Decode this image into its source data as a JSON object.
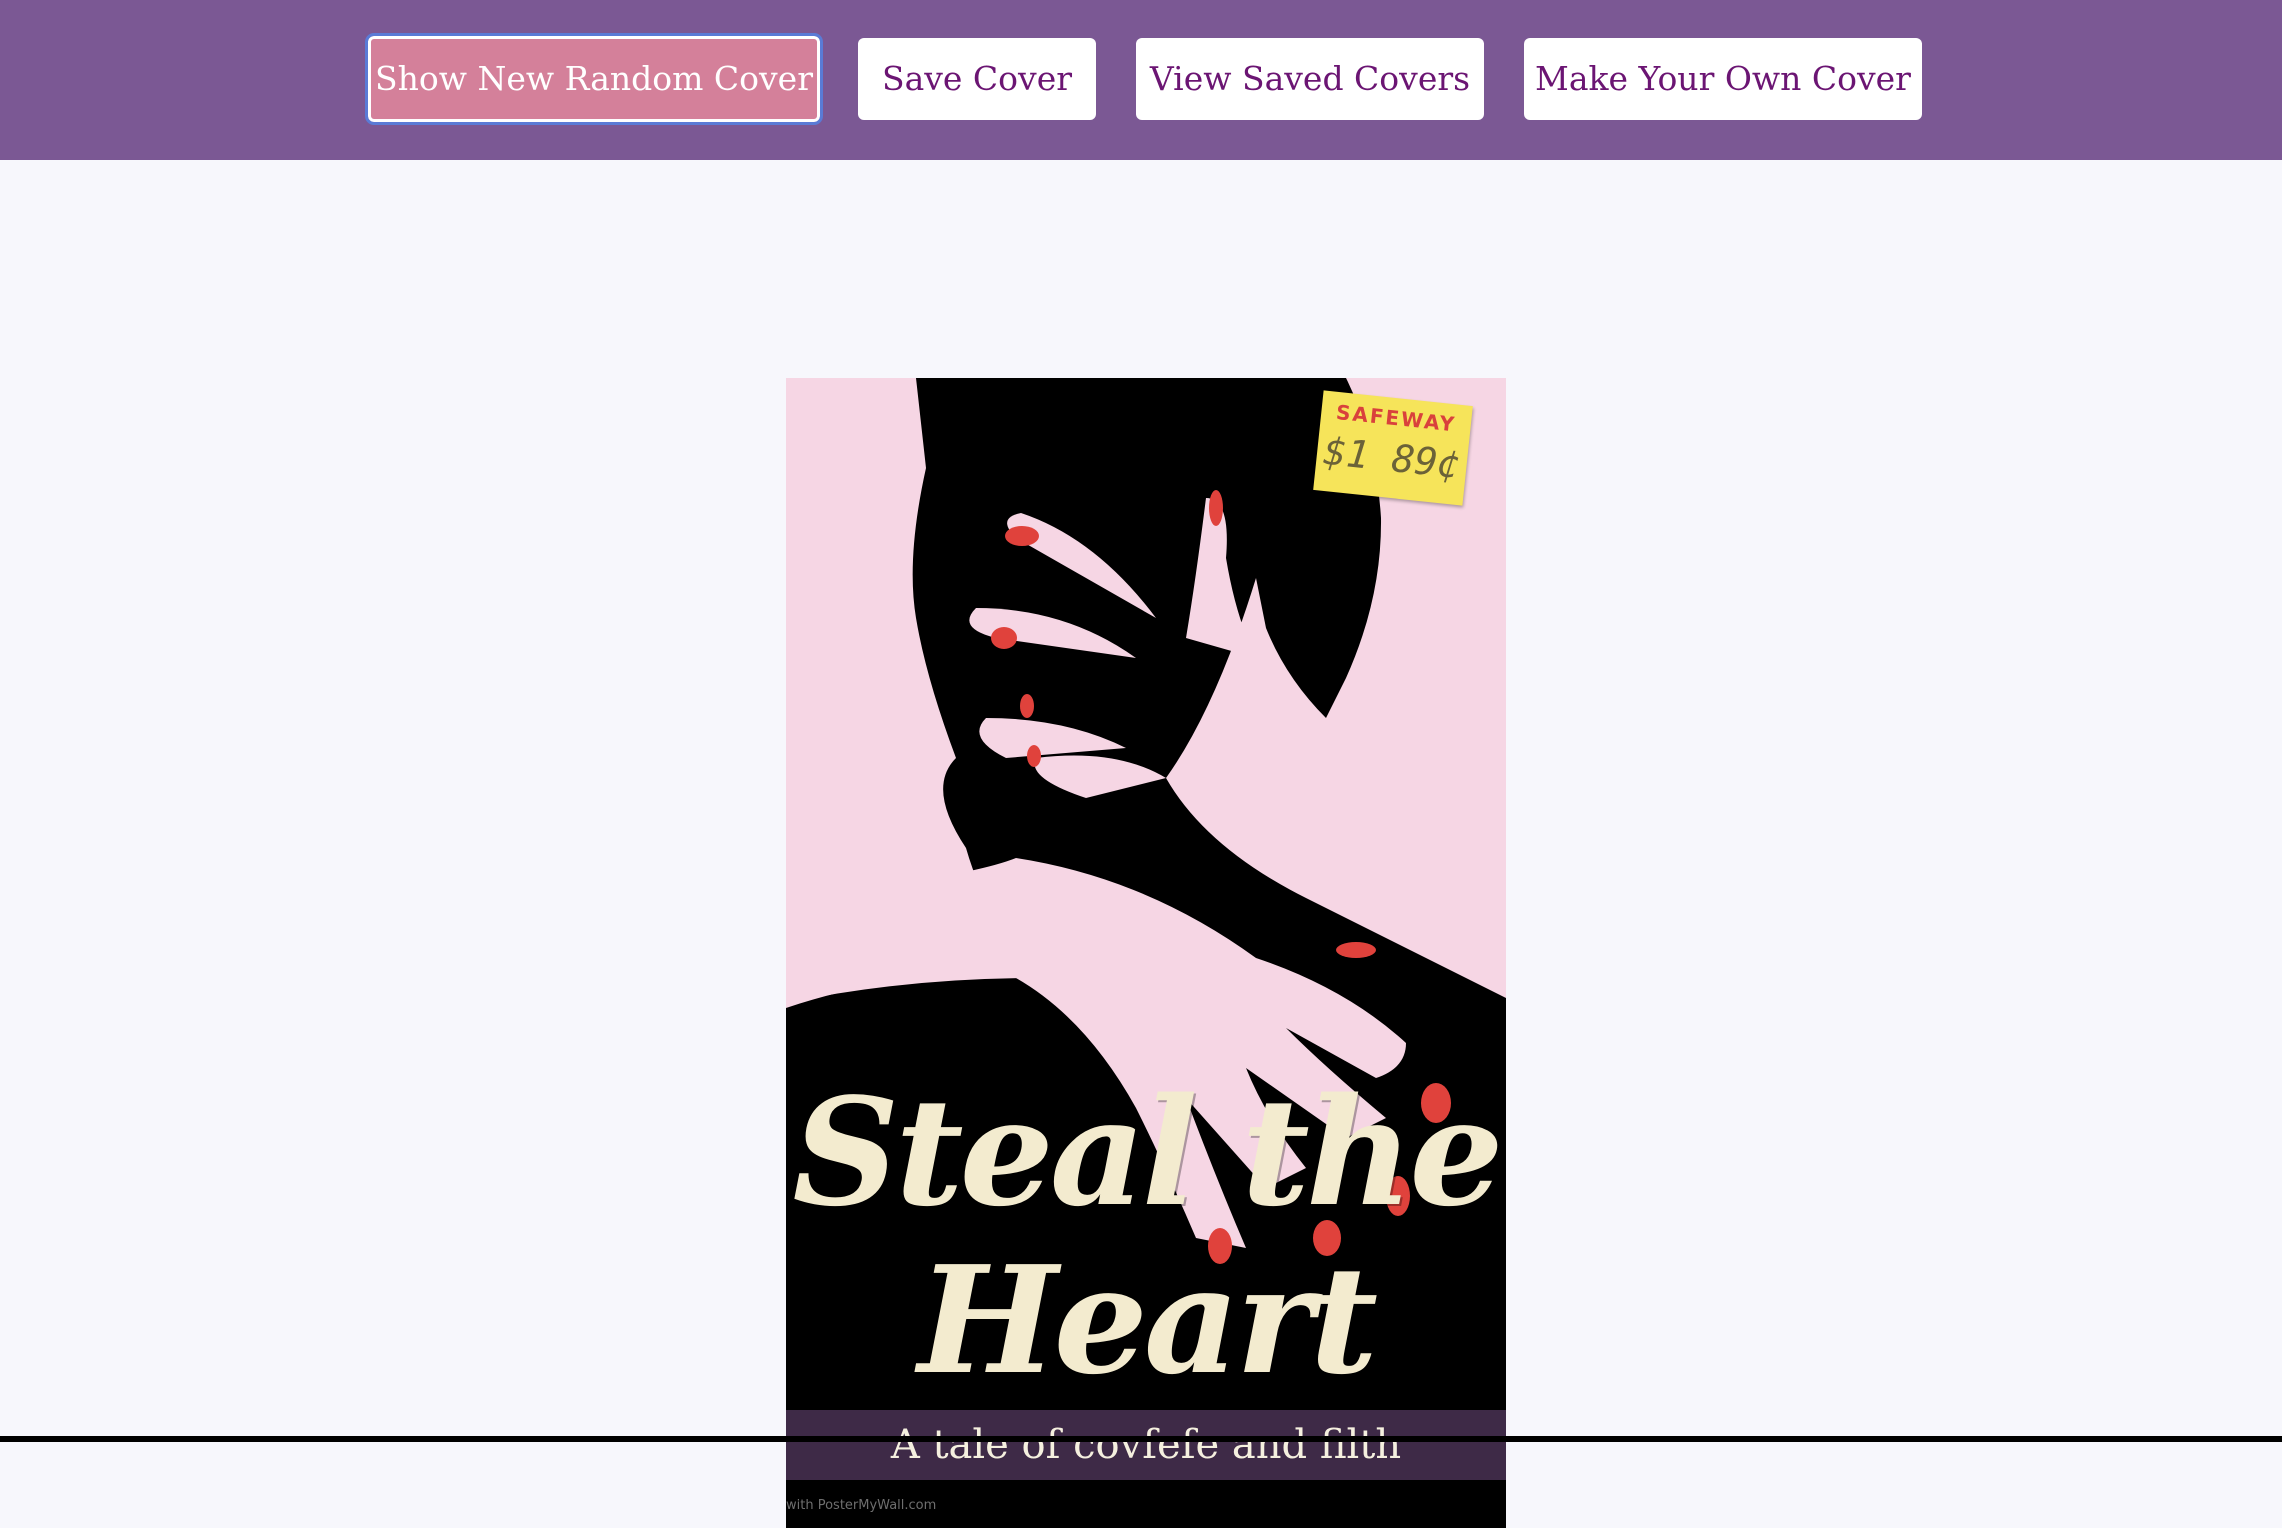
{
  "nav": {
    "random_label": "Show New Random Cover",
    "save_label": "Save Cover",
    "view_label": "View Saved Covers",
    "make_label": "Make Your Own Cover"
  },
  "cover": {
    "title_line1": "Steal the",
    "title_line2": "Heart",
    "tagline": "A tale of covfefe and filth",
    "watermark": "with PosterMyWall.com",
    "sticker_store": "SAFEWAY",
    "sticker_price": "$1 89¢"
  },
  "colors": {
    "navbar": "#7b5894",
    "active_button": "#d4809a",
    "button_text": "#6b1573",
    "cover_pink": "#f6d6e4",
    "title_cream": "#f3ebcf",
    "tagline_bar": "#3e2a47",
    "nail_red": "#e0423c"
  }
}
